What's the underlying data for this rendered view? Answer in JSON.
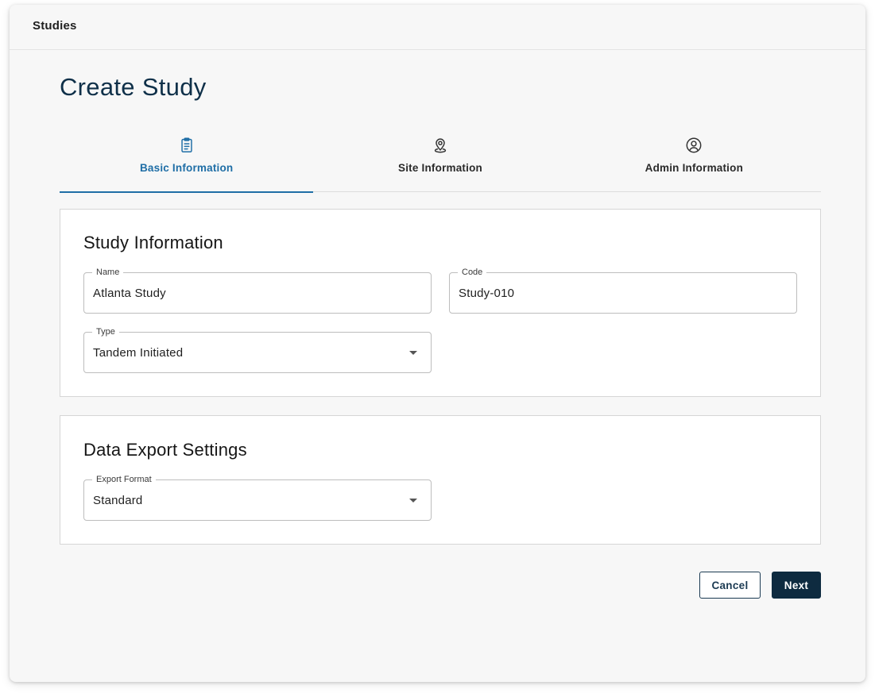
{
  "topbar": {
    "title": "Studies"
  },
  "page": {
    "title": "Create Study"
  },
  "tabs": [
    {
      "label": "Basic Information",
      "icon": "clipboard-icon",
      "active": true
    },
    {
      "label": "Site Information",
      "icon": "map-pin-icon",
      "active": false
    },
    {
      "label": "Admin Information",
      "icon": "user-circle-icon",
      "active": false
    }
  ],
  "study_info": {
    "title": "Study Information",
    "name": {
      "label": "Name",
      "value": "Atlanta Study"
    },
    "code": {
      "label": "Code",
      "value": "Study-010"
    },
    "type": {
      "label": "Type",
      "value": "Tandem Initiated"
    }
  },
  "export_settings": {
    "title": "Data Export Settings",
    "format": {
      "label": "Export Format",
      "value": "Standard"
    }
  },
  "actions": {
    "cancel_label": "Cancel",
    "next_label": "Next"
  },
  "colors": {
    "accent": "#1f6ea6",
    "title": "#0f3049",
    "primary_button": "#0e2b40"
  }
}
